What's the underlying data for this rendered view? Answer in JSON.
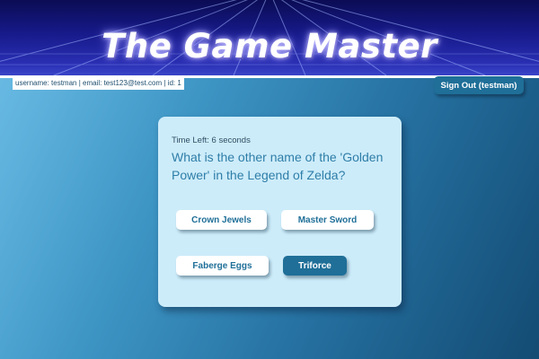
{
  "banner": {
    "title": "The Game Master"
  },
  "user_info": {
    "text": "username: testman | email: test123@test.com | id: 1"
  },
  "signout": {
    "label": "Sign Out (testman)"
  },
  "quiz": {
    "timer_text": "Time Left: 6 seconds",
    "question": "What is the other name of the 'Golden Power' in the Legend of Zelda?",
    "answers": [
      {
        "label": "Crown Jewels"
      },
      {
        "label": "Master Sword"
      },
      {
        "label": "Faberge Eggs"
      },
      {
        "label": "Triforce"
      }
    ]
  },
  "colors": {
    "banner_dark": "#0b0c54",
    "accent_button": "#1f6f98",
    "card_background": "#cdecfa",
    "question_text": "#2f7ea8"
  }
}
